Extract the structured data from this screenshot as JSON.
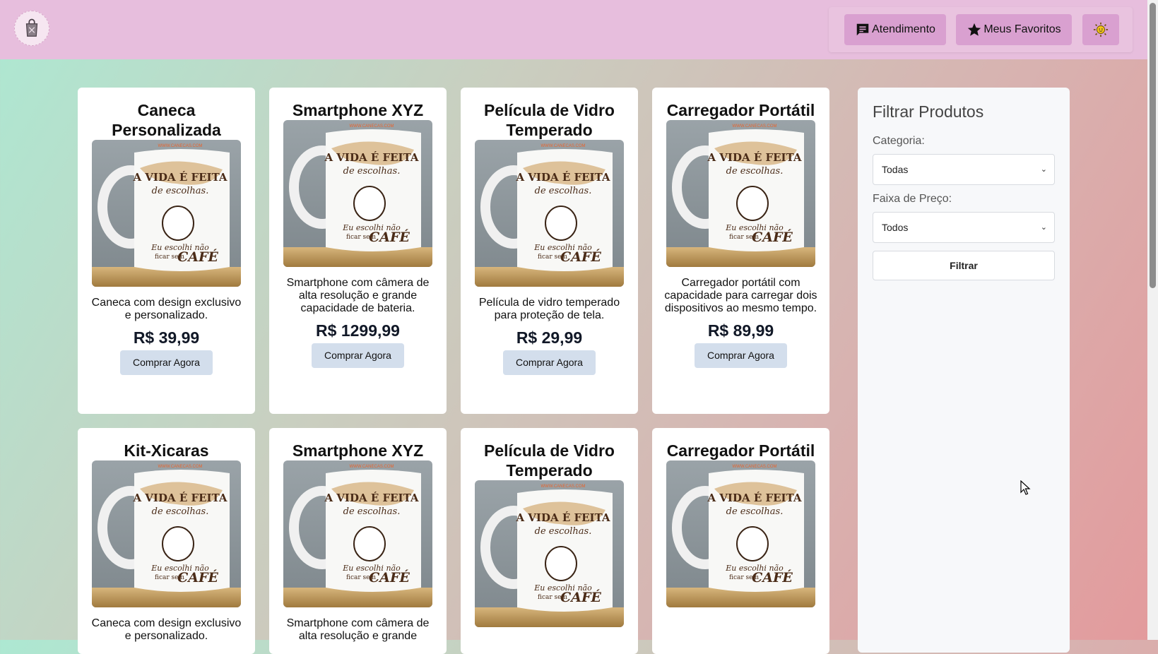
{
  "header": {
    "logo_icon": "shopping-bag-icon",
    "nav": [
      {
        "label": "Atendimento",
        "icon": "chat-icon"
      },
      {
        "label": "Meus Favoritos",
        "icon": "star-icon"
      },
      {
        "label": "",
        "icon": "sun-icon"
      }
    ]
  },
  "products": [
    {
      "title": "Caneca Personalizada",
      "description": "Caneca com design exclusivo e personalizado.",
      "price": "R$ 39,99",
      "button": "Comprar Agora"
    },
    {
      "title": "Smartphone XYZ",
      "description": "Smartphone com câmera de alta resolução e grande capacidade de bateria.",
      "price": "R$ 1299,99",
      "button": "Comprar Agora"
    },
    {
      "title": "Película de Vidro Temperado",
      "description": "Película de vidro temperado para proteção de tela.",
      "price": "R$ 29,99",
      "button": "Comprar Agora"
    },
    {
      "title": "Carregador Portátil",
      "description": "Carregador portátil com capacidade para carregar dois dispositivos ao mesmo tempo.",
      "price": "R$ 89,99",
      "button": "Comprar Agora"
    },
    {
      "title": "Kit-Xicaras",
      "description": "Caneca com design exclusivo e personalizado.",
      "price": "",
      "button": ""
    },
    {
      "title": "Smartphone XYZ",
      "description": "Smartphone com câmera de alta resolução e grande",
      "price": "",
      "button": ""
    },
    {
      "title": "Película de Vidro Temperado",
      "description": "",
      "price": "",
      "button": ""
    },
    {
      "title": "Carregador Portátil",
      "description": "",
      "price": "",
      "button": ""
    }
  ],
  "mug_art": {
    "line1": "A VIDA É FEITA",
    "line2": "de escolhas.",
    "line3": "Eu escolhi não",
    "line4": "ficar sem",
    "line5": "CAFÉ"
  },
  "filter": {
    "title": "Filtrar Produtos",
    "category_label": "Categoria:",
    "category_value": "Todas",
    "price_label": "Faixa de Preço:",
    "price_value": "Todos",
    "button": "Filtrar"
  },
  "colors": {
    "header": "#e7bedd",
    "nav_button": "#d9a0d0",
    "buy_button": "#d3deec"
  }
}
